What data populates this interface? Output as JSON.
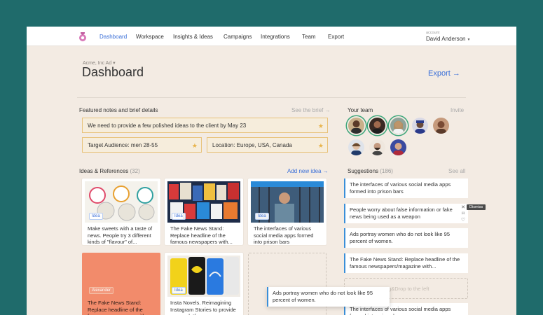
{
  "nav": {
    "items": [
      {
        "label": "Dashboard",
        "active": true
      },
      {
        "label": "Workspace"
      },
      {
        "label": "Insights & Ideas"
      },
      {
        "label": "Campaigns"
      },
      {
        "label": "Integrations"
      },
      {
        "label": "Team"
      },
      {
        "label": "Export"
      }
    ],
    "account_label": "account",
    "account_name": "David Anderson",
    "account_caret": "▾"
  },
  "header": {
    "breadcrumb": "Acme, Inc Ad ▾",
    "title": "Dashboard",
    "export_label": "Export →"
  },
  "featured": {
    "title": "Featured notes and brief details",
    "see_brief": "See the brief →",
    "notes": [
      {
        "text": "We need to provide a few polished ideas to the client by May 23"
      },
      {
        "text": "Target Audience: men 28-55"
      },
      {
        "text": "Location: Europe, USA, Canada"
      }
    ],
    "star_glyph": "★"
  },
  "team": {
    "title": "Your team",
    "invite": "Invite"
  },
  "ideas": {
    "title": "Ideas & References",
    "count": "(32)",
    "add_label": "Add new idea →",
    "cards": [
      {
        "text": "Make sweets with a taste of news. People try 3 different kinds of \"flavour\" of...",
        "tag": "Idea"
      },
      {
        "text": "The Fake News Stand: Replace headline of the famous newspapers with...",
        "tag": "Idea"
      },
      {
        "text": "The interfaces of various social media apps formed into prison bars",
        "tag": "Idea"
      },
      {
        "text": "The Fake News Stand: Replace headline of the famous newspapers with...",
        "tag": "Alexander"
      },
      {
        "text": "Insta Novels. Reimagining Instagram Stories to provide a new platform...",
        "tag": "Idea"
      }
    ],
    "drag_text": "Drag&Drop to the left"
  },
  "suggestions": {
    "title": "Suggestions",
    "count": "(186)",
    "see_all": "See all",
    "items": [
      {
        "text": "The interfaces of various social media apps formed into prison bars"
      },
      {
        "text": "People worry about false information or fake news being used as a weapon"
      },
      {
        "text": "Ads portray women who do not look like 95 percent of women."
      },
      {
        "text": "The Fake News Stand: Replace headline of the famous newspapers/magazine with..."
      },
      {
        "text": "The interfaces of various social media apps formed into prison bars"
      }
    ],
    "dismiss_label": "Dismiss",
    "close_glyph": "✕",
    "bookmark_glyph": "⌑",
    "heart_glyph": "♡"
  },
  "floating_card": {
    "text": "Ads portray women who do not look like 95 percent of women."
  },
  "colors": {
    "accent": "#3a6fd8",
    "background_outer": "#1f6b6b",
    "page_bg": "#f3ebe3",
    "note_border": "#e8c27a",
    "star": "#e8b34a",
    "orange_card": "#f28b6b",
    "team_ring": "#3ea67b"
  }
}
